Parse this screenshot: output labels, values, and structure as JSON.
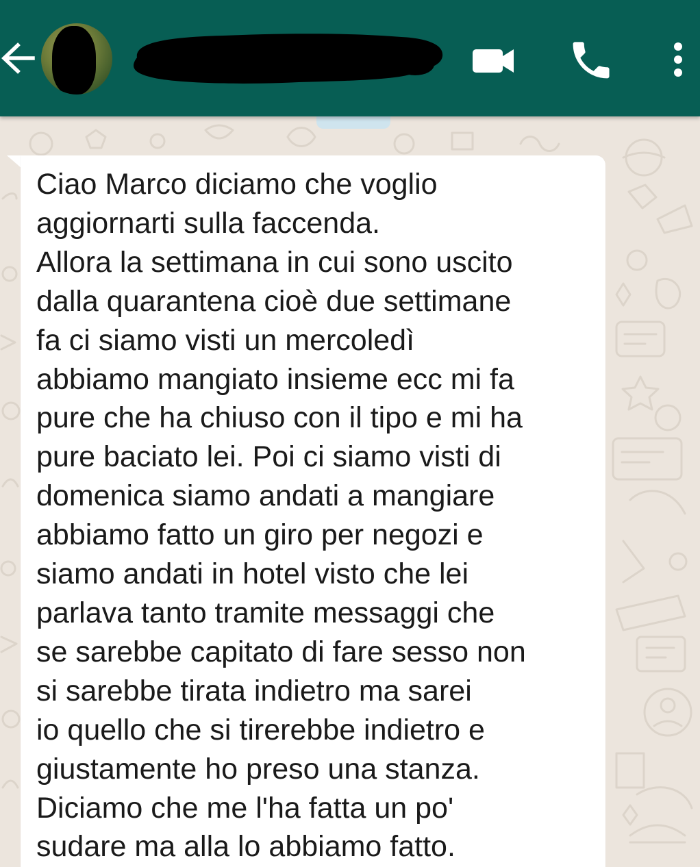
{
  "header": {
    "back_icon": "arrow-left-icon",
    "contact_name": "",
    "video_call_icon": "videocam-icon",
    "voice_call_icon": "phone-icon",
    "menu_icon": "more-vertical-icon",
    "bar_color": "#075E54"
  },
  "chat": {
    "background_color": "#ECE5DD",
    "messages": [
      {
        "direction": "incoming",
        "bubble_color": "#FFFFFF",
        "text": "Ciao Marco diciamo che voglio\naggiornarti sulla faccenda.\nAllora la settimana in cui sono uscito\ndalla quarantena cioè due settimane\nfa ci siamo visti un mercoledì\nabbiamo mangiato insieme ecc mi fa\npure che ha chiuso con il tipo e mi ha\npure baciato lei. Poi ci siamo visti di\ndomenica siamo andati a mangiare\nabbiamo fatto un giro per negozi e\nsiamo andati in hotel visto che lei\nparlava tanto tramite messaggi che\nse sarebbe capitato di fare sesso non\nsi sarebbe tirata indietro ma sarei\nio quello che si tirerebbe indietro e\ngiustamente ho preso una stanza.\nDiciamo che me l'ha fatta un po'\nsudare ma alla lo abbiamo fatto."
      }
    ]
  }
}
